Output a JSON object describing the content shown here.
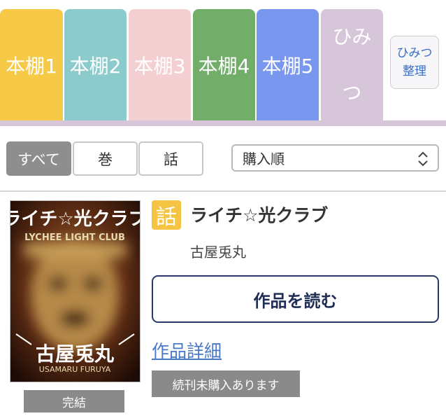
{
  "shelf_tabs": [
    {
      "label": "本棚1",
      "color": "#f6ca47"
    },
    {
      "label": "本棚2",
      "color": "#8bcbcc"
    },
    {
      "label": "本棚3",
      "color": "#f4cfd2"
    },
    {
      "label": "本棚4",
      "color": "#72ae6a"
    },
    {
      "label": "本棚5",
      "color": "#7a97ef"
    },
    {
      "label": "ひみつ",
      "color": "#d7c6da"
    }
  ],
  "secret_manage": {
    "line1": "ひみつ",
    "line2": "整理"
  },
  "filters": {
    "segments": [
      {
        "label": "すべて",
        "active": true
      },
      {
        "label": "巻",
        "active": false
      },
      {
        "label": "話",
        "active": false
      }
    ],
    "sort_value": "購入順"
  },
  "item": {
    "type_badge": "話",
    "title": "ライチ☆光クラブ",
    "author": "古屋兎丸",
    "status": "完結",
    "read_button": "作品を読む",
    "detail_link": "作品詳細",
    "notice": "続刊未購入あります",
    "cover": {
      "title_art": "ライチ☆光クラブ",
      "author_art": "古屋兎丸",
      "roman_title": "LYCHEE LIGHT CLUB",
      "roman_author": "USAMARU FURUYA"
    }
  },
  "colors": {
    "accent_navy": "#1f2d56",
    "link_blue": "#4a78c9",
    "badge_gray": "#8a8a8a",
    "tab_underline": "#d7c6da"
  }
}
